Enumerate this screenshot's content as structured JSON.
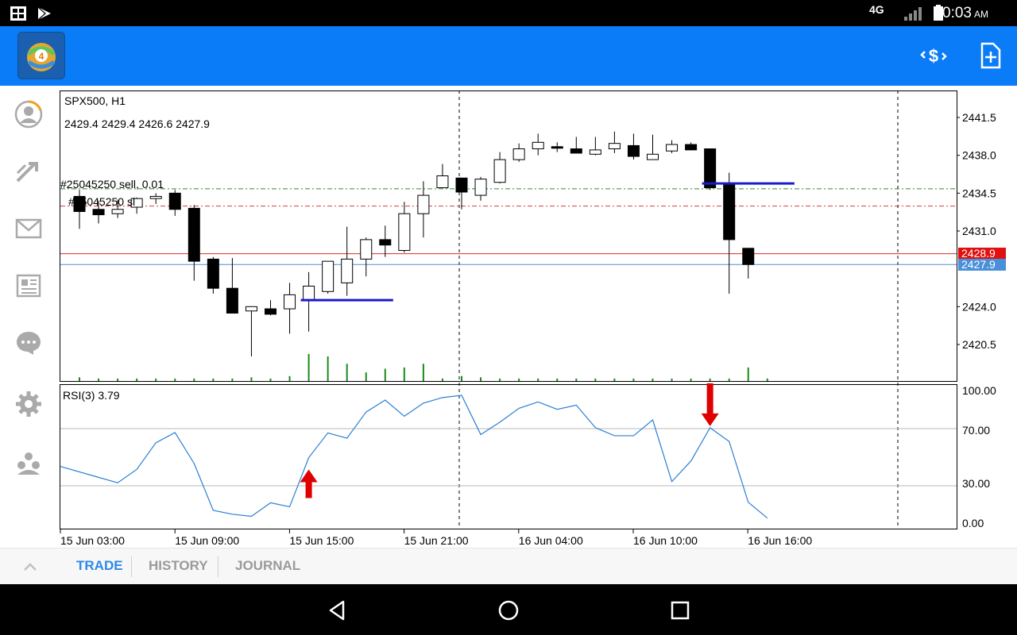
{
  "status_bar": {
    "time": "10:03",
    "ampm": "AM",
    "network": "4G"
  },
  "icons": {
    "status_left": [
      "gallery-icon",
      "play-store-icon"
    ],
    "status_right": [
      "network-4g-icon",
      "signal-icon",
      "battery-icon"
    ],
    "appbar": [
      "metatrader-logo-icon",
      "trade-currency-icon",
      "new-order-icon"
    ],
    "sidebar": [
      "account-icon",
      "trade-icon",
      "mail-icon",
      "news-icon",
      "chat-icon",
      "settings-icon",
      "community-icon"
    ],
    "nav": [
      "back-icon",
      "home-icon",
      "recents-icon"
    ]
  },
  "chart": {
    "symbol_label": "SPX500, H1",
    "ohlc_label": "2429.4 2429.4 2426.6 2427.9",
    "order_label": "#25045250 sell, 0.01",
    "sl_label": "#25045250 sl",
    "price_ticks": [
      "2441.5",
      "2438.0",
      "2434.5",
      "2431.0",
      "2424.0",
      "2420.5"
    ],
    "bid_price": "2428.9",
    "ask_price": "2427.9",
    "rsi_label": "RSI(3) 3.79",
    "rsi_ticks": [
      "100.00",
      "70.00",
      "30.00",
      "0.00"
    ],
    "time_labels": [
      "15 Jun 03:00",
      "15 Jun 09:00",
      "15 Jun 15:00",
      "15 Jun 21:00",
      "16 Jun 04:00",
      "16 Jun 10:00",
      "16 Jun 16:00"
    ],
    "colors": {
      "bid_line": "#d32f2f",
      "ask_line": "#4a90d9",
      "level_line": "#1a1acc",
      "rsi_line": "#2a7fd4",
      "volume": "#1a8a1a",
      "arrow": "#e00000"
    }
  },
  "chart_data": {
    "type": "candlestick",
    "ylim": [
      2417.0,
      2443.0
    ],
    "candles": [
      {
        "o": 2434.2,
        "h": 2434.8,
        "l": 2431.2,
        "c": 2432.8
      },
      {
        "o": 2433.0,
        "h": 2433.8,
        "l": 2431.7,
        "c": 2432.5
      },
      {
        "o": 2432.6,
        "h": 2433.9,
        "l": 2432.2,
        "c": 2433.0
      },
      {
        "o": 2433.2,
        "h": 2434.1,
        "l": 2432.6,
        "c": 2434.0
      },
      {
        "o": 2434.0,
        "h": 2434.5,
        "l": 2433.5,
        "c": 2434.2
      },
      {
        "o": 2434.5,
        "h": 2434.8,
        "l": 2432.4,
        "c": 2433.0
      },
      {
        "o": 2433.1,
        "h": 2433.4,
        "l": 2426.4,
        "c": 2428.2
      },
      {
        "o": 2428.4,
        "h": 2428.6,
        "l": 2425.2,
        "c": 2425.7
      },
      {
        "o": 2425.7,
        "h": 2428.5,
        "l": 2424.0,
        "c": 2423.4
      },
      {
        "o": 2423.6,
        "h": 2423.9,
        "l": 2419.4,
        "c": 2424.0
      },
      {
        "o": 2423.8,
        "h": 2424.6,
        "l": 2423.2,
        "c": 2423.3
      },
      {
        "o": 2423.8,
        "h": 2426.2,
        "l": 2421.5,
        "c": 2425.1
      },
      {
        "o": 2424.6,
        "h": 2427.2,
        "l": 2421.7,
        "c": 2425.9
      },
      {
        "o": 2425.4,
        "h": 2428.0,
        "l": 2425.2,
        "c": 2428.2
      },
      {
        "o": 2426.2,
        "h": 2431.4,
        "l": 2425.0,
        "c": 2428.4
      },
      {
        "o": 2428.4,
        "h": 2430.4,
        "l": 2426.8,
        "c": 2430.2
      },
      {
        "o": 2430.2,
        "h": 2431.5,
        "l": 2428.6,
        "c": 2429.7
      },
      {
        "o": 2429.2,
        "h": 2433.7,
        "l": 2429.0,
        "c": 2432.6
      },
      {
        "o": 2432.6,
        "h": 2435.6,
        "l": 2430.4,
        "c": 2434.3
      },
      {
        "o": 2435.0,
        "h": 2437.2,
        "l": 2435.0,
        "c": 2436.1
      },
      {
        "o": 2435.9,
        "h": 2435.9,
        "l": 2433.0,
        "c": 2434.6
      },
      {
        "o": 2434.3,
        "h": 2436.0,
        "l": 2433.8,
        "c": 2435.8
      },
      {
        "o": 2435.5,
        "h": 2438.3,
        "l": 2435.4,
        "c": 2437.6
      },
      {
        "o": 2437.6,
        "h": 2439.1,
        "l": 2437.4,
        "c": 2438.6
      },
      {
        "o": 2438.6,
        "h": 2440.0,
        "l": 2438.0,
        "c": 2439.2
      },
      {
        "o": 2438.8,
        "h": 2439.2,
        "l": 2438.3,
        "c": 2438.7
      },
      {
        "o": 2438.6,
        "h": 2439.7,
        "l": 2438.3,
        "c": 2438.2
      },
      {
        "o": 2438.1,
        "h": 2439.7,
        "l": 2438.0,
        "c": 2438.5
      },
      {
        "o": 2438.6,
        "h": 2440.2,
        "l": 2438.2,
        "c": 2439.1
      },
      {
        "o": 2438.9,
        "h": 2440.0,
        "l": 2437.6,
        "c": 2437.9
      },
      {
        "o": 2437.6,
        "h": 2439.9,
        "l": 2437.6,
        "c": 2438.1
      },
      {
        "o": 2438.4,
        "h": 2439.4,
        "l": 2438.2,
        "c": 2439.0
      },
      {
        "o": 2439.0,
        "h": 2439.2,
        "l": 2438.8,
        "c": 2438.5
      },
      {
        "o": 2438.6,
        "h": 2438.6,
        "l": 2434.8,
        "c": 2435.0
      },
      {
        "o": 2435.4,
        "h": 2436.4,
        "l": 2425.2,
        "c": 2430.2
      },
      {
        "o": 2429.4,
        "h": 2429.4,
        "l": 2426.6,
        "c": 2427.9
      }
    ],
    "volumes": [
      3,
      2,
      2,
      2,
      2,
      2,
      2,
      2,
      2,
      3,
      2,
      4,
      22,
      20,
      14,
      7,
      10,
      11,
      14,
      2,
      4,
      3,
      2,
      2,
      2,
      2,
      2,
      2,
      2,
      2,
      2,
      2,
      2,
      2,
      2,
      11,
      2
    ],
    "rsi": [
      42.7,
      34.5,
      30.4,
      40.5,
      60.6,
      68.3,
      45.0,
      9.6,
      6.7,
      5.1,
      15.3,
      12.3,
      49.4,
      68.0,
      64.0,
      83.8,
      92.8,
      80.6,
      90.5,
      94.7,
      96.4,
      66.8,
      76.1,
      86.6,
      91.4,
      85.8,
      89.0,
      72.0,
      65.9,
      65.9,
      77.8,
      31.3,
      46.8,
      71.9,
      61.6,
      15.7,
      3.79
    ],
    "rsi_ylim": [
      0,
      100
    ],
    "level_lines": [
      {
        "price": 2424.6,
        "from_index": 12,
        "to_index": 16
      },
      {
        "price": 2435.4,
        "from_index": 33,
        "to_index": 37
      }
    ],
    "order_price": 2434.9,
    "sl_price": 2433.3,
    "bid": 2428.9,
    "ask": 2427.9,
    "signals": [
      {
        "index": 12,
        "direction": "up"
      },
      {
        "index": 33,
        "direction": "down"
      }
    ]
  },
  "tabs": [
    "TRADE",
    "HISTORY",
    "JOURNAL"
  ],
  "active_tab": "TRADE"
}
